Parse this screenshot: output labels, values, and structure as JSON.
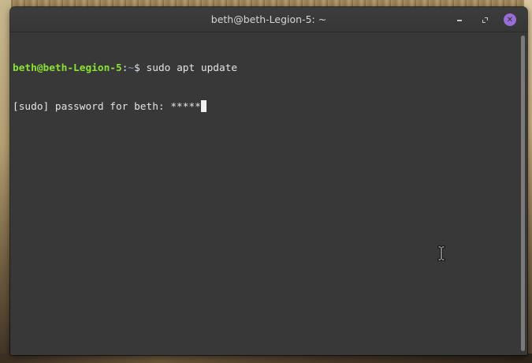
{
  "window": {
    "title": "beth@beth-Legion-5: ~"
  },
  "controls": {
    "minimize_icon": "minimize-icon",
    "maximize_icon": "maximize-icon",
    "close_icon": "close-icon",
    "close_glyph": "✕",
    "close_color": "#9a6cd6"
  },
  "terminal": {
    "prompt_user_host": "beth@beth-Legion-5",
    "prompt_sep": ":",
    "prompt_path": "~",
    "prompt_symbol": "$ ",
    "command": "sudo apt update",
    "password_prompt": "[sudo] password for beth: ",
    "password_mask": "*****",
    "user_color": "#8ae234",
    "path_color": "#729fcf",
    "text_color": "#e4e4e4",
    "background": "#383838"
  }
}
